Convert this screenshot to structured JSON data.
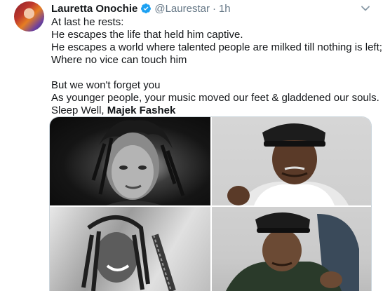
{
  "tweet": {
    "author_name": "Lauretta Onochie",
    "handle": "@Laurestar",
    "separator": "·",
    "time": "1h",
    "lines": [
      "At last he rests:",
      "He escapes the life that held him captive.",
      "He escapes a world where talented people are milked till nothing is left;",
      "Where no vice can touch him",
      "",
      "But we won't forget you",
      "As younger people, your music moved our feet & gladdened our souls."
    ],
    "closing_prefix": "Sleep Well, ",
    "closing_name": "Majek Fashek"
  },
  "icons": {
    "verified": "verified-badge-icon",
    "menu": "chevron-down-icon"
  },
  "colors": {
    "verified": "#1da1f2",
    "secondary_text": "#657786",
    "primary_text": "#14171a"
  }
}
